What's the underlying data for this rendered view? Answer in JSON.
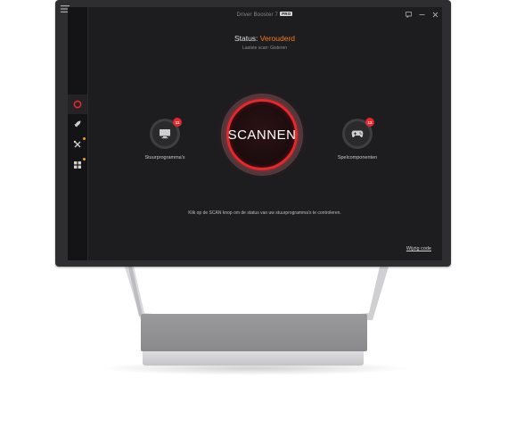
{
  "window": {
    "title": "Driver Booster 7",
    "edition": "PRO"
  },
  "status": {
    "label": "Status:",
    "value": "Verouderd",
    "last_scan": "Laatste scan: Gisteren"
  },
  "scan_button": {
    "label": "SCANNEN"
  },
  "components": [
    {
      "label": "Stuurprogramma's",
      "badge": "11",
      "icon": "monitor-icon"
    },
    {
      "label": "Spelcomponenten",
      "badge": "12",
      "icon": "gamepad-icon"
    }
  ],
  "hint": "Klik op de SCAN knop om de status van uw stuurprogramma's te controleren.",
  "footer": {
    "enter_code": "Wijzig code"
  },
  "sidebar": {
    "items": [
      {
        "icon": "scan-target-icon",
        "active": true
      },
      {
        "icon": "rocket-icon",
        "active": false
      },
      {
        "icon": "tools-icon",
        "active": false,
        "dot": true
      },
      {
        "icon": "apps-grid-icon",
        "active": false,
        "dot": true
      }
    ]
  },
  "colors": {
    "accent_red": "#e8262c",
    "status_orange": "#f47b20",
    "background": "#1d1d20"
  }
}
